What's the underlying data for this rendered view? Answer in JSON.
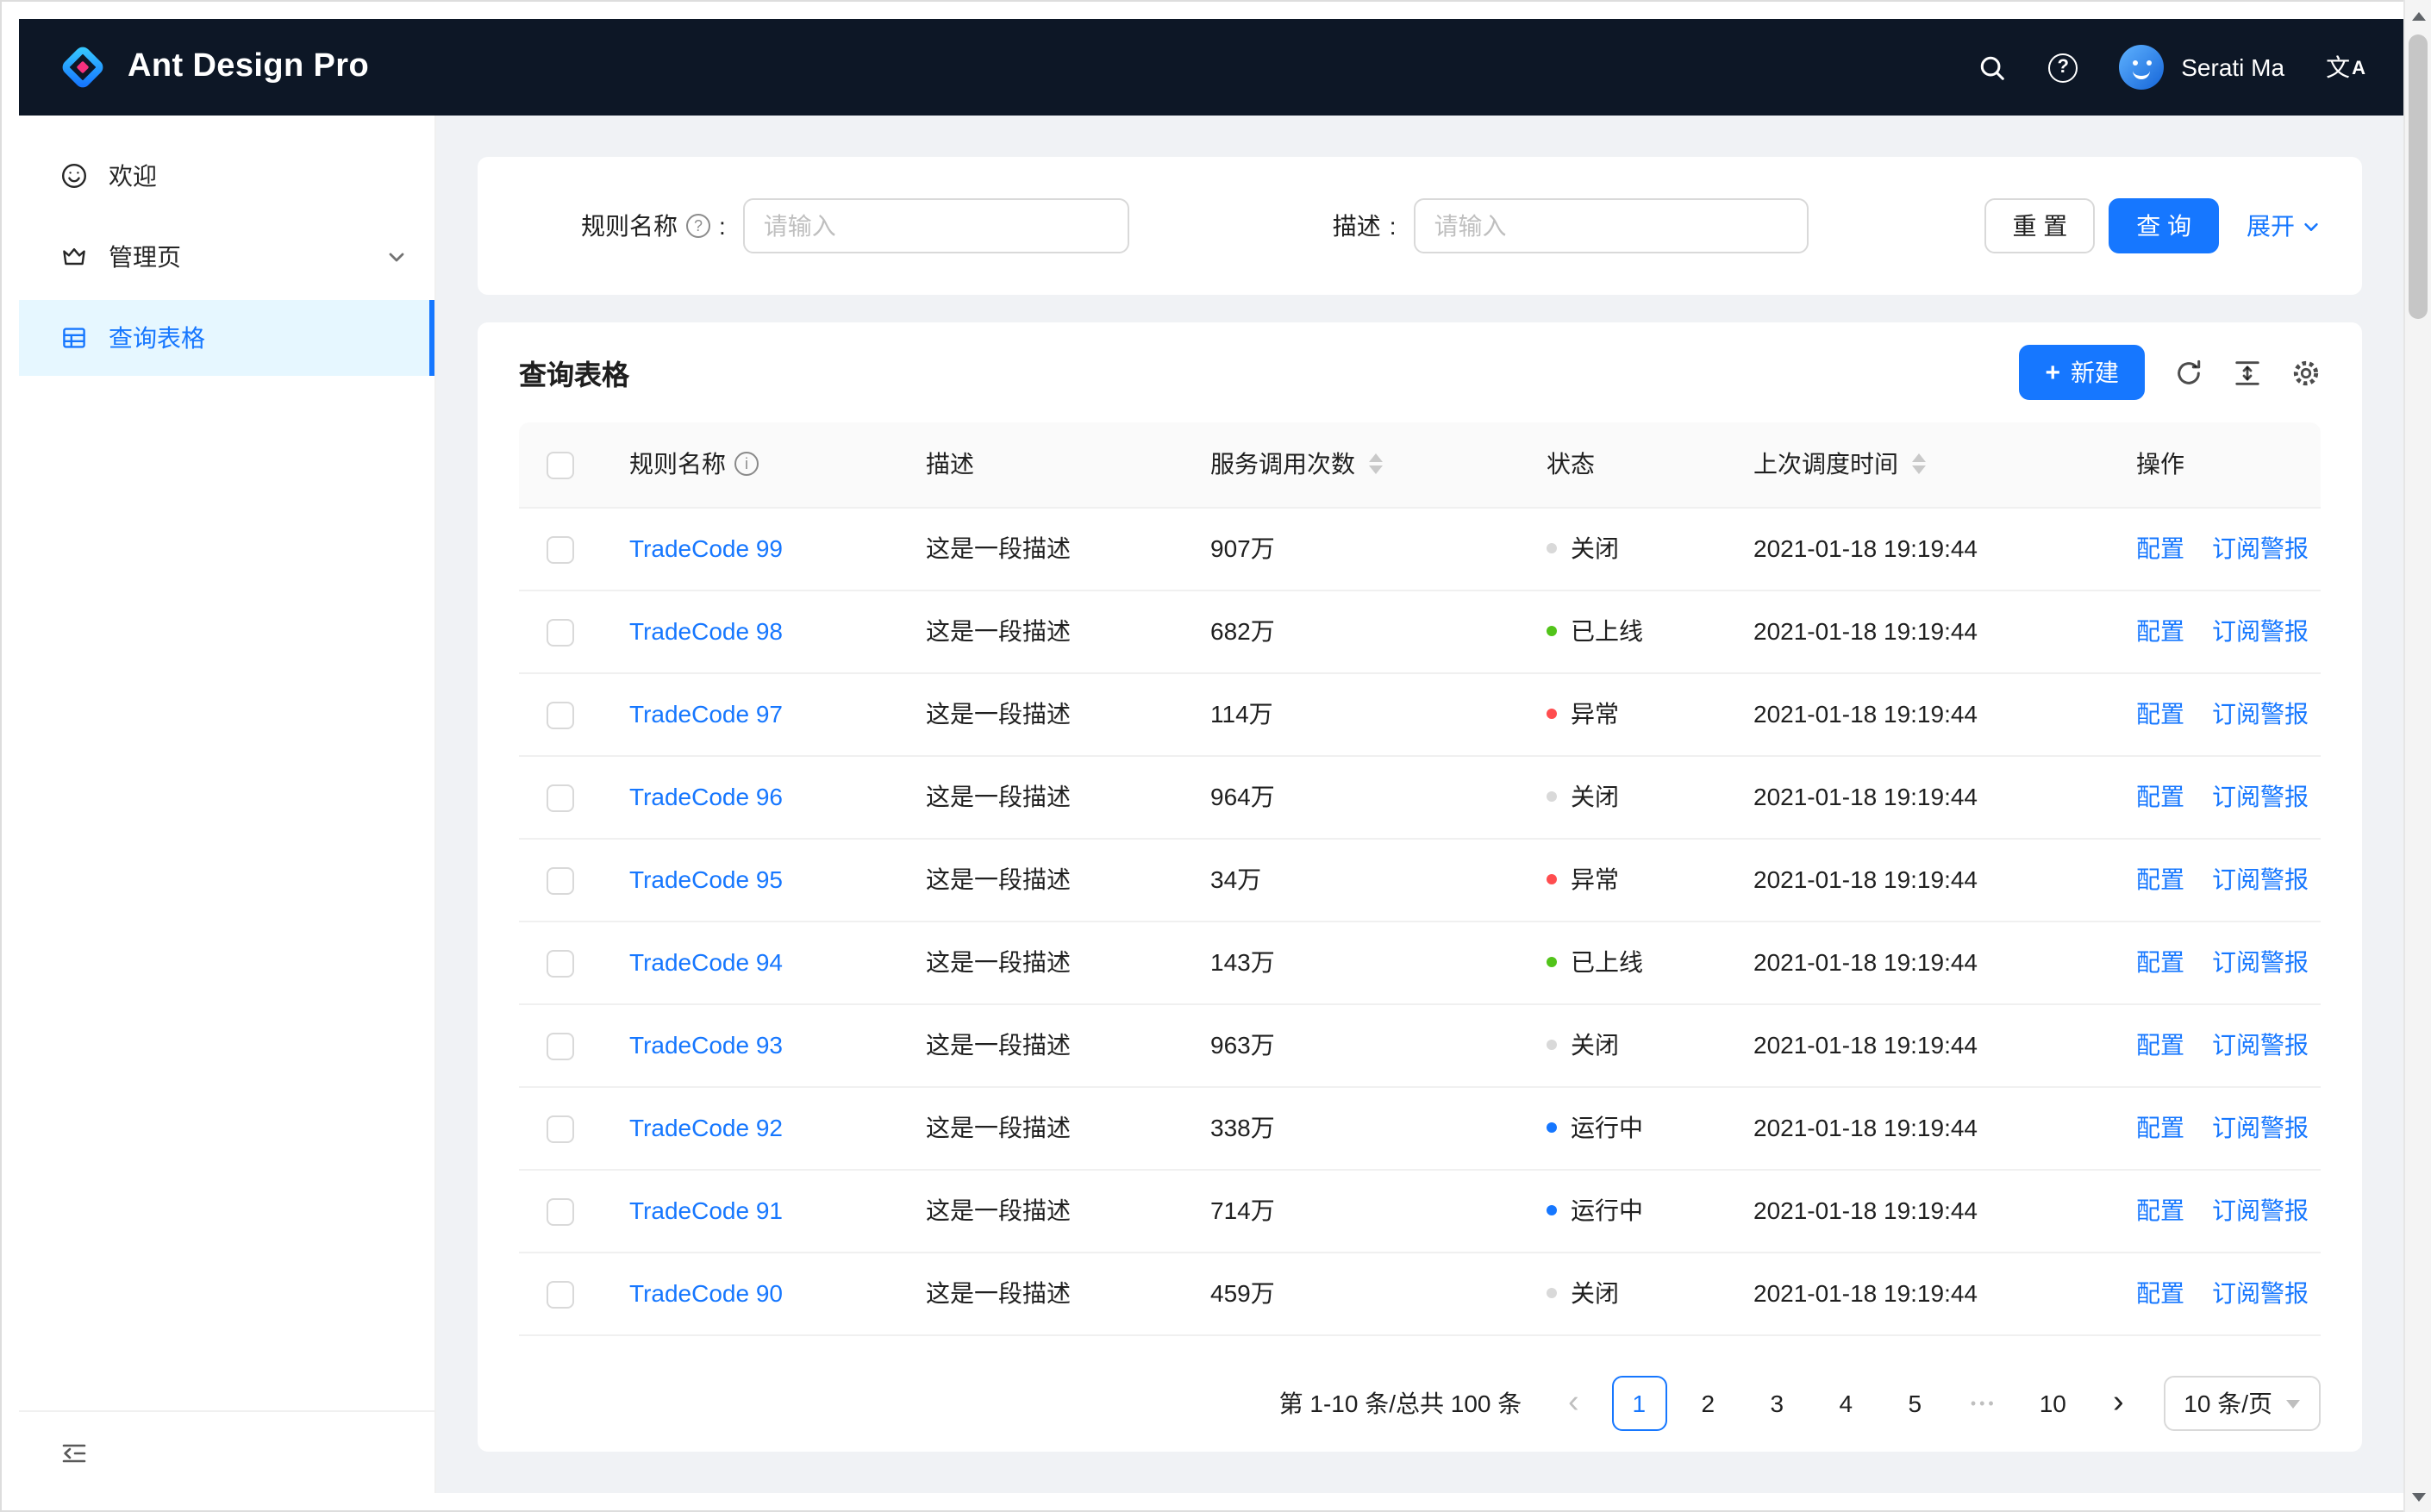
{
  "navbar": {
    "title": "Ant Design Pro",
    "user_name": "Serati Ma"
  },
  "sidebar": {
    "items": [
      {
        "label": "欢迎",
        "icon": "smile-icon"
      },
      {
        "label": "管理页",
        "icon": "crown-icon"
      },
      {
        "label": "查询表格",
        "icon": "table-icon"
      }
    ]
  },
  "filter": {
    "name_label": "规则名称",
    "colon": ":",
    "name_placeholder": "请输入",
    "desc_label": "描述",
    "desc_placeholder": "请输入",
    "reset_label": "重 置",
    "query_label": "查 询",
    "expand_label": "展开"
  },
  "table": {
    "title": "查询表格",
    "plus": "+",
    "new_label": "新建",
    "columns": [
      "规则名称",
      "描述",
      "服务调用次数",
      "状态",
      "上次调度时间",
      "操作"
    ],
    "ops": [
      "配置",
      "订阅警报"
    ],
    "rows": [
      {
        "name": "TradeCode 99",
        "desc": "这是一段描述",
        "calls": "907万",
        "status": "关闭",
        "status_type": "default",
        "time": "2021-01-18 19:19:44"
      },
      {
        "name": "TradeCode 98",
        "desc": "这是一段描述",
        "calls": "682万",
        "status": "已上线",
        "status_type": "success",
        "time": "2021-01-18 19:19:44"
      },
      {
        "name": "TradeCode 97",
        "desc": "这是一段描述",
        "calls": "114万",
        "status": "异常",
        "status_type": "error",
        "time": "2021-01-18 19:19:44"
      },
      {
        "name": "TradeCode 96",
        "desc": "这是一段描述",
        "calls": "964万",
        "status": "关闭",
        "status_type": "default",
        "time": "2021-01-18 19:19:44"
      },
      {
        "name": "TradeCode 95",
        "desc": "这是一段描述",
        "calls": "34万",
        "status": "异常",
        "status_type": "error",
        "time": "2021-01-18 19:19:44"
      },
      {
        "name": "TradeCode 94",
        "desc": "这是一段描述",
        "calls": "143万",
        "status": "已上线",
        "status_type": "success",
        "time": "2021-01-18 19:19:44"
      },
      {
        "name": "TradeCode 93",
        "desc": "这是一段描述",
        "calls": "963万",
        "status": "关闭",
        "status_type": "default",
        "time": "2021-01-18 19:19:44"
      },
      {
        "name": "TradeCode 92",
        "desc": "这是一段描述",
        "calls": "338万",
        "status": "运行中",
        "status_type": "processing",
        "time": "2021-01-18 19:19:44"
      },
      {
        "name": "TradeCode 91",
        "desc": "这是一段描述",
        "calls": "714万",
        "status": "运行中",
        "status_type": "processing",
        "time": "2021-01-18 19:19:44"
      },
      {
        "name": "TradeCode 90",
        "desc": "这是一段描述",
        "calls": "459万",
        "status": "关闭",
        "status_type": "default",
        "time": "2021-01-18 19:19:44"
      }
    ]
  },
  "pagination": {
    "summary": "第 1-10 条/总共 100 条",
    "prev": "‹",
    "next": "›",
    "items": [
      "1",
      "2",
      "3",
      "4",
      "5",
      "•••",
      "10"
    ],
    "active": "1",
    "size_label": "10 条/页"
  },
  "colors": {
    "primary": "#1677ff",
    "status": {
      "default": "#d9d9d9",
      "success": "#52c41a",
      "error": "#ff4d4f",
      "processing": "#1677ff"
    }
  }
}
